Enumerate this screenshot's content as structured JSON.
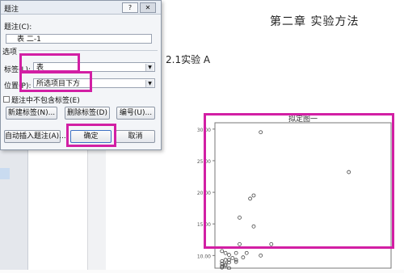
{
  "document": {
    "chapter_title": "第二章  实验方法",
    "section_title": "2.1实验 A"
  },
  "dialog": {
    "title": "题注",
    "help_label": "?",
    "close_label": "✕",
    "caption_label": "题注(C):",
    "caption_value": "表 二-1",
    "options_label": "选项",
    "label_label": "标签(L):",
    "label_value": "表",
    "position_label": "位置(P):",
    "position_value": "所选项目下方",
    "exclude_label": "题注中不包含标签(E)",
    "new_label_button": "新建标签(N)...",
    "delete_label_button": "删除标签(D)",
    "numbering_button": "编号(U)...",
    "autocaption_button": "自动插入题注(A)...",
    "ok_button": "确定",
    "cancel_button": "取消"
  },
  "chart_data": {
    "type": "scatter",
    "title": "拟定图一",
    "ylabel": "",
    "yticks": [
      "30.00",
      "25.00",
      "20.00",
      "15.00",
      "10.00"
    ],
    "ylim": [
      8,
      31
    ],
    "x": [
      1.3,
      3.8,
      1.1,
      1.0,
      0.7,
      1.1,
      1.6,
      0.7,
      0.2,
      0.3,
      0.6,
      0.9,
      1.3,
      0.4,
      0.5,
      0.8,
      0.3,
      0.2,
      0.4,
      0.6,
      0.2,
      0.3,
      0.4,
      0.6,
      0.2,
      0.3,
      0.2,
      0.4
    ],
    "y": [
      29.5,
      23.2,
      19.5,
      19.0,
      16.0,
      14.6,
      11.8,
      11.8,
      10.7,
      10.4,
      10.4,
      10.4,
      10.0,
      10.1,
      9.6,
      9.7,
      9.3,
      9.1,
      9.3,
      9.3,
      8.7,
      8.6,
      8.9,
      9.0,
      8.3,
      8.4,
      8.1,
      8.0
    ],
    "xlim": [
      0,
      5
    ]
  },
  "colors": {
    "highlight": "#d21fa4",
    "chart_point": "#444444"
  }
}
